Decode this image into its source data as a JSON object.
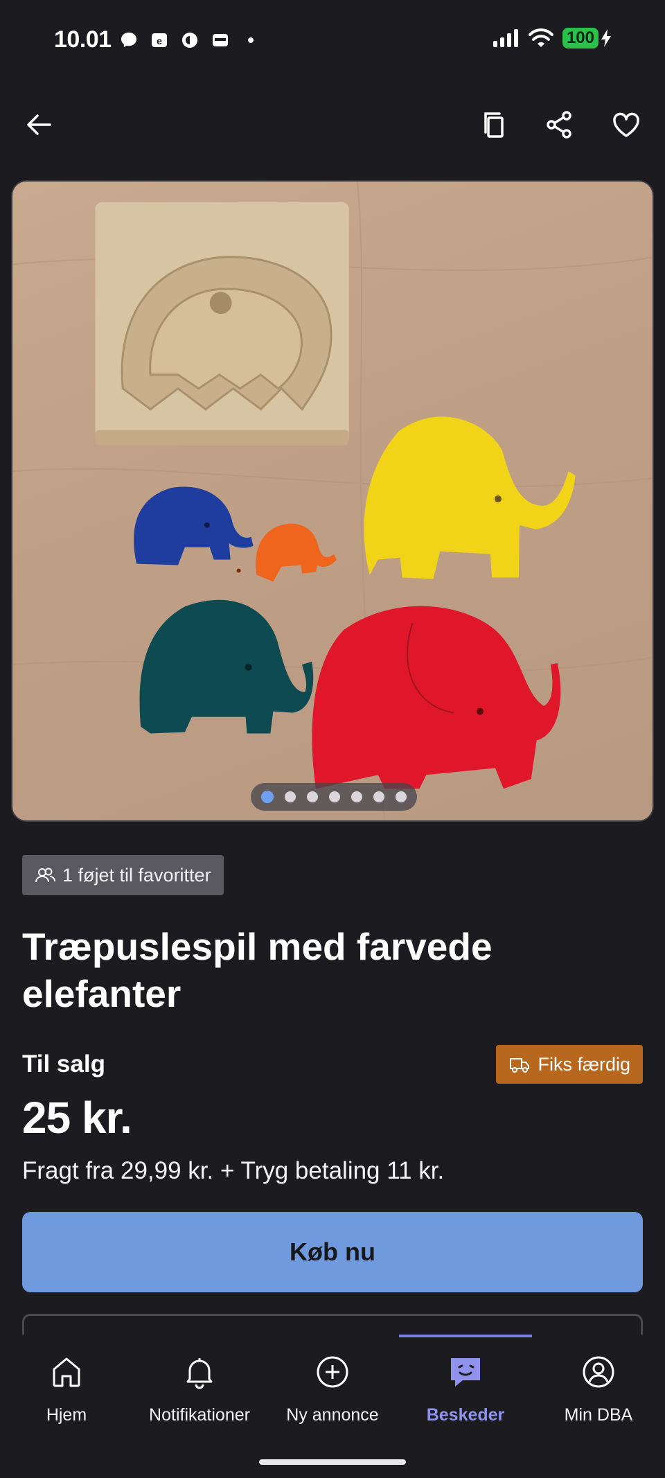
{
  "status_bar": {
    "time": "10.01",
    "battery": "100",
    "icons": [
      "messenger-icon",
      "news-icon",
      "app-icon",
      "wallet-icon",
      "dot-icon",
      "signal-icon",
      "wifi-icon",
      "charging-icon"
    ]
  },
  "app_bar": {
    "icons": [
      "back-arrow-icon",
      "copy-icon",
      "share-icon",
      "heart-icon"
    ]
  },
  "photo": {
    "subject": "wooden elephant puzzle",
    "page_count": 7,
    "current_page": 1,
    "colors": {
      "yellow": "#f1d417",
      "blue": "#1f3d9e",
      "orange": "#f0651e",
      "teal": "#0e4a52",
      "red": "#e0172a"
    }
  },
  "listing": {
    "favorites_chip": "1 føjet til favoritter",
    "title": "Træpuslespil med farvede elefanter",
    "sale_label": "Til salg",
    "shipping_chip": "Fiks færdig",
    "price": "25 kr.",
    "shipping_text": "Fragt fra 29,99 kr. + Tryg betaling 11 kr.",
    "buy_button": "Køb nu"
  },
  "bottom_nav": {
    "items": [
      {
        "label": "Hjem",
        "icon": "home-icon"
      },
      {
        "label": "Notifikationer",
        "icon": "bell-icon"
      },
      {
        "label": "Ny annonce",
        "icon": "plus-circle-icon"
      },
      {
        "label": "Beskeder",
        "icon": "chat-icon",
        "active": true
      },
      {
        "label": "Min DBA",
        "icon": "profile-icon"
      }
    ]
  },
  "colors": {
    "background": "#1c1b20",
    "accent": "#6f9bde",
    "active_nav": "#8f93ec",
    "fiks_chip": "#b8671f",
    "battery": "#2ac04a"
  }
}
